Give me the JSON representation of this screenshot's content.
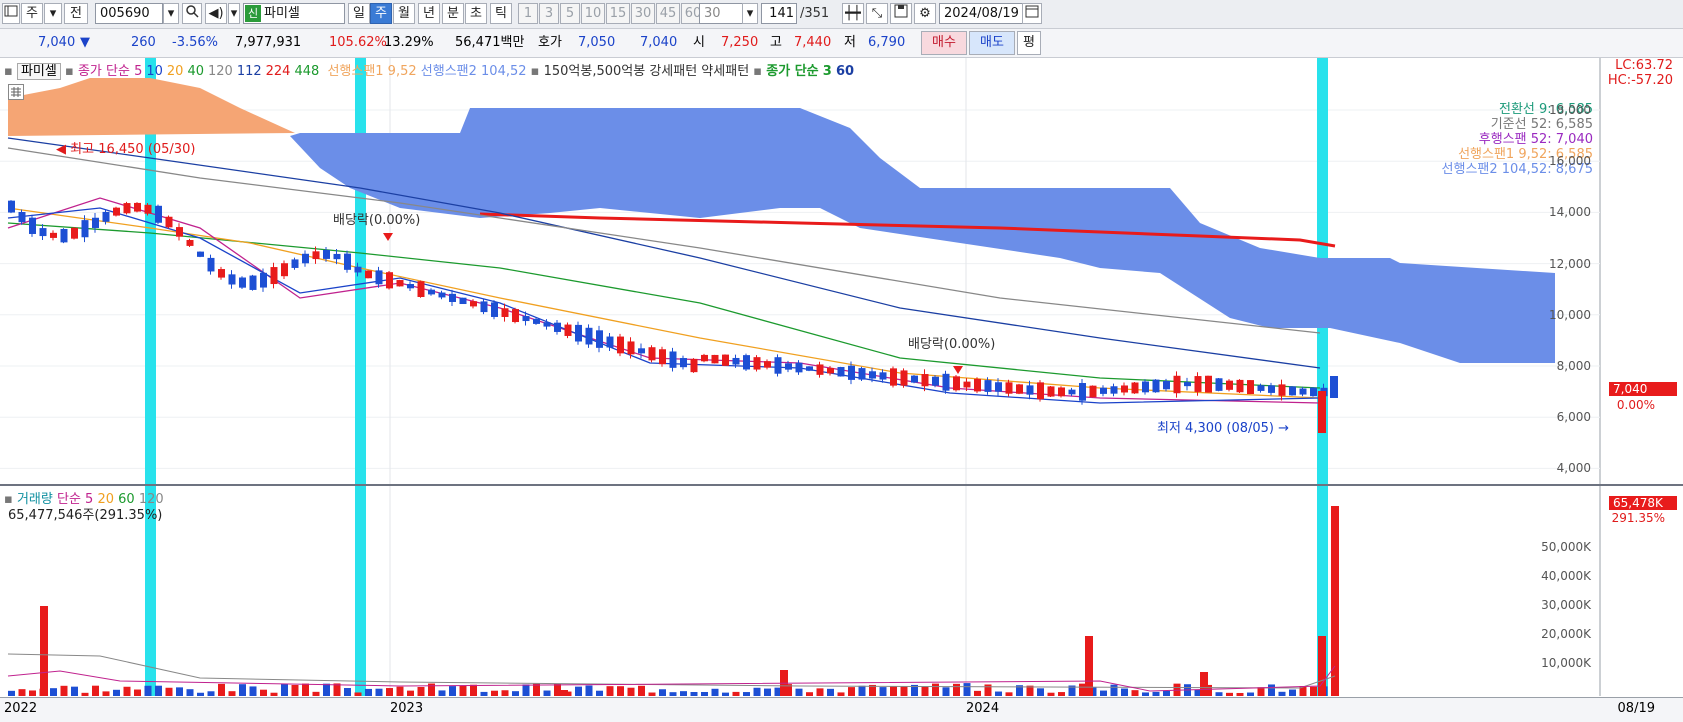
{
  "toolbar": {
    "period_label": "주",
    "prev_label": "전",
    "stock_code": "005690",
    "stock_name": "파미셀",
    "new_tag": "신",
    "timeframes": [
      "일",
      "주",
      "월",
      "년",
      "분",
      "초",
      "틱"
    ],
    "active_timeframe": "주",
    "intervals": [
      "1",
      "3",
      "5",
      "10",
      "15",
      "30",
      "45",
      "60"
    ],
    "interval_value": "30",
    "count_value": "141",
    "count_total": "/351",
    "date": "2024/08/19"
  },
  "info": {
    "price": "7,040",
    "change_arrow": "▼",
    "change": "260",
    "change_pct": "-3.56%",
    "volume": "7,977,931",
    "volume_ratio": "105.62%",
    "turnover": "13.29%",
    "amount": "56,471백만",
    "quote_label": "호가",
    "ask": "7,050",
    "bid": "7,040",
    "open_label": "시",
    "open": "7,250",
    "high_label": "고",
    "high": "7,440",
    "low_label": "저",
    "low": "6,790",
    "buy_label": "매수",
    "sell_label": "매도",
    "eval_label": "평"
  },
  "price_chart": {
    "legend": {
      "name": "파미셀",
      "ma_label": "종가 단순",
      "ma_periods": [
        "5",
        "10",
        "20",
        "40",
        "120",
        "112",
        "224",
        "448"
      ],
      "span1": "선행스팬1 9,52",
      "span2": "선행스팬2 104,52",
      "pattern": "150억봉,500억봉 강세패턴  약세패턴",
      "ma2_label": "종가 단순",
      "ma2_periods": [
        "3",
        "60"
      ]
    },
    "right_top": [
      "LC:63.72",
      "HC:-57.20"
    ],
    "ichimoku_labels": [
      "전환선 9: 6,585",
      "기준선 52: 6,585",
      "후행스팬 52: 7,040",
      "선행스팬1 9,52: 6,585",
      "선행스팬2 104,52: 8,675"
    ],
    "y_ticks": [
      "18,000",
      "16,000",
      "14,000",
      "12,000",
      "10,000",
      "8,000",
      "6,000",
      "4,000"
    ],
    "current_price_box": "7,040",
    "current_pct": "0.00%",
    "annotations": {
      "high": "최고 16,450 (05/30)",
      "low": "최저 4,300 (08/05)",
      "dividend1": "배당락(0.00%)",
      "dividend2": "배당락(0.00%)"
    },
    "colors": {
      "cloud_bull": "#f5a574",
      "cloud_bear": "#6b8ee8",
      "highlight": "#28e2ec",
      "up": "#e81b1b",
      "down": "#1d4fd4"
    }
  },
  "volume_chart": {
    "legend": {
      "name": "거래량",
      "ma_label": "단순",
      "ma_periods": [
        "5",
        "20",
        "60",
        "120"
      ],
      "value": "65,477,546주(291.35%)"
    },
    "y_ticks": [
      "50,000K",
      "40,000K",
      "30,000K",
      "20,000K",
      "10,000K"
    ],
    "current_box": "65,478K",
    "current_pct": "291.35%"
  },
  "x_axis": {
    "labels": [
      "2022",
      "2023",
      "2024"
    ],
    "last_label": "08/19"
  }
}
